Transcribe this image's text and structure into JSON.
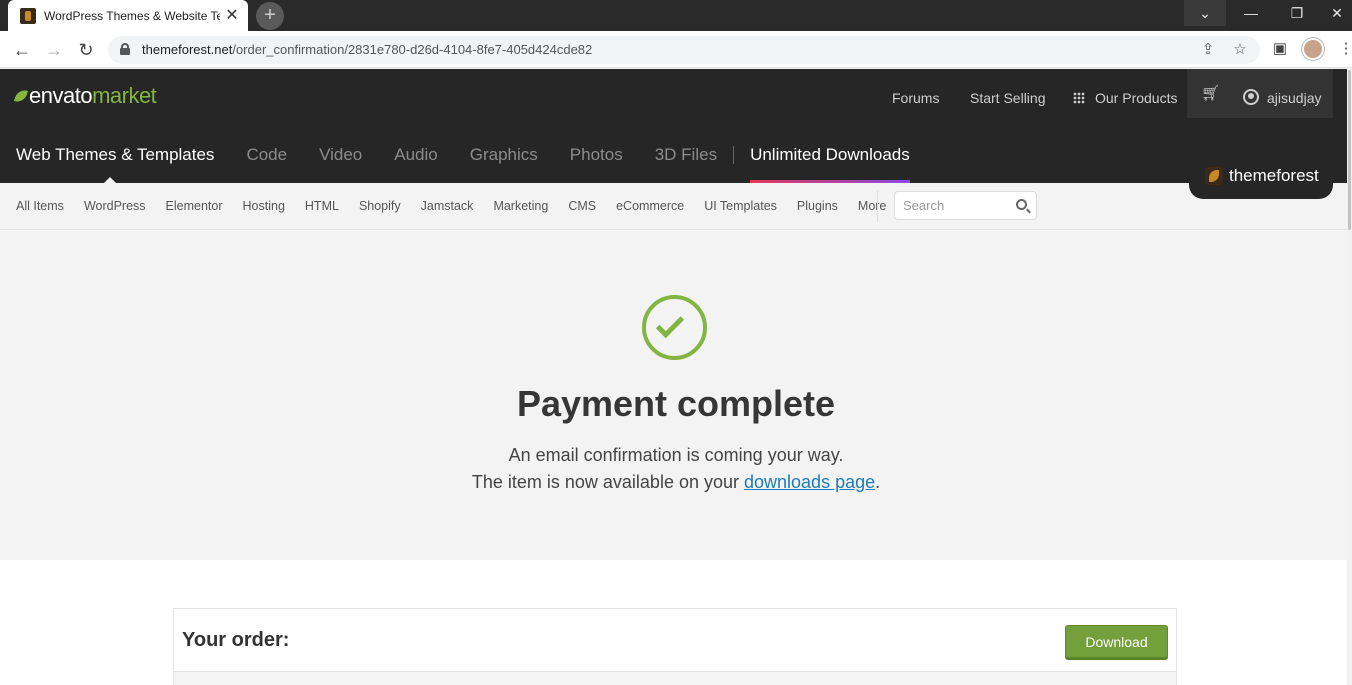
{
  "browser": {
    "tab_title": "WordPress Themes & Website Te",
    "url_domain": "themeforest.net",
    "url_path": "/order_confirmation/2831e780-d26d-4104-8fe7-405d424cde82"
  },
  "header": {
    "logo_envato": "envato",
    "logo_market": "market",
    "links": {
      "forums": "Forums",
      "start_selling": "Start Selling",
      "our_products": "Our Products"
    },
    "username": "ajisudjay",
    "badge": "themeforest"
  },
  "categories": {
    "items": [
      "Web Themes & Templates",
      "Code",
      "Video",
      "Audio",
      "Graphics",
      "Photos",
      "3D Files"
    ],
    "unlimited": "Unlimited Downloads",
    "active_index": 0
  },
  "subnav": {
    "items": [
      "All Items",
      "WordPress",
      "Elementor",
      "Hosting",
      "HTML",
      "Shopify",
      "Jamstack",
      "Marketing",
      "CMS",
      "eCommerce",
      "UI Templates",
      "Plugins",
      "More"
    ],
    "search_placeholder": "Search"
  },
  "confirmation": {
    "title": "Payment complete",
    "line1": "An email confirmation is coming your way.",
    "line2_prefix": "The item is now available on your ",
    "line2_link": "downloads page",
    "line2_suffix": "."
  },
  "order": {
    "title": "Your order:",
    "download_label": "Download"
  },
  "colors": {
    "envato_green": "#82b541",
    "button_green": "#73a03a",
    "link_blue": "#1f7bb8",
    "header_dark": "#262626"
  }
}
